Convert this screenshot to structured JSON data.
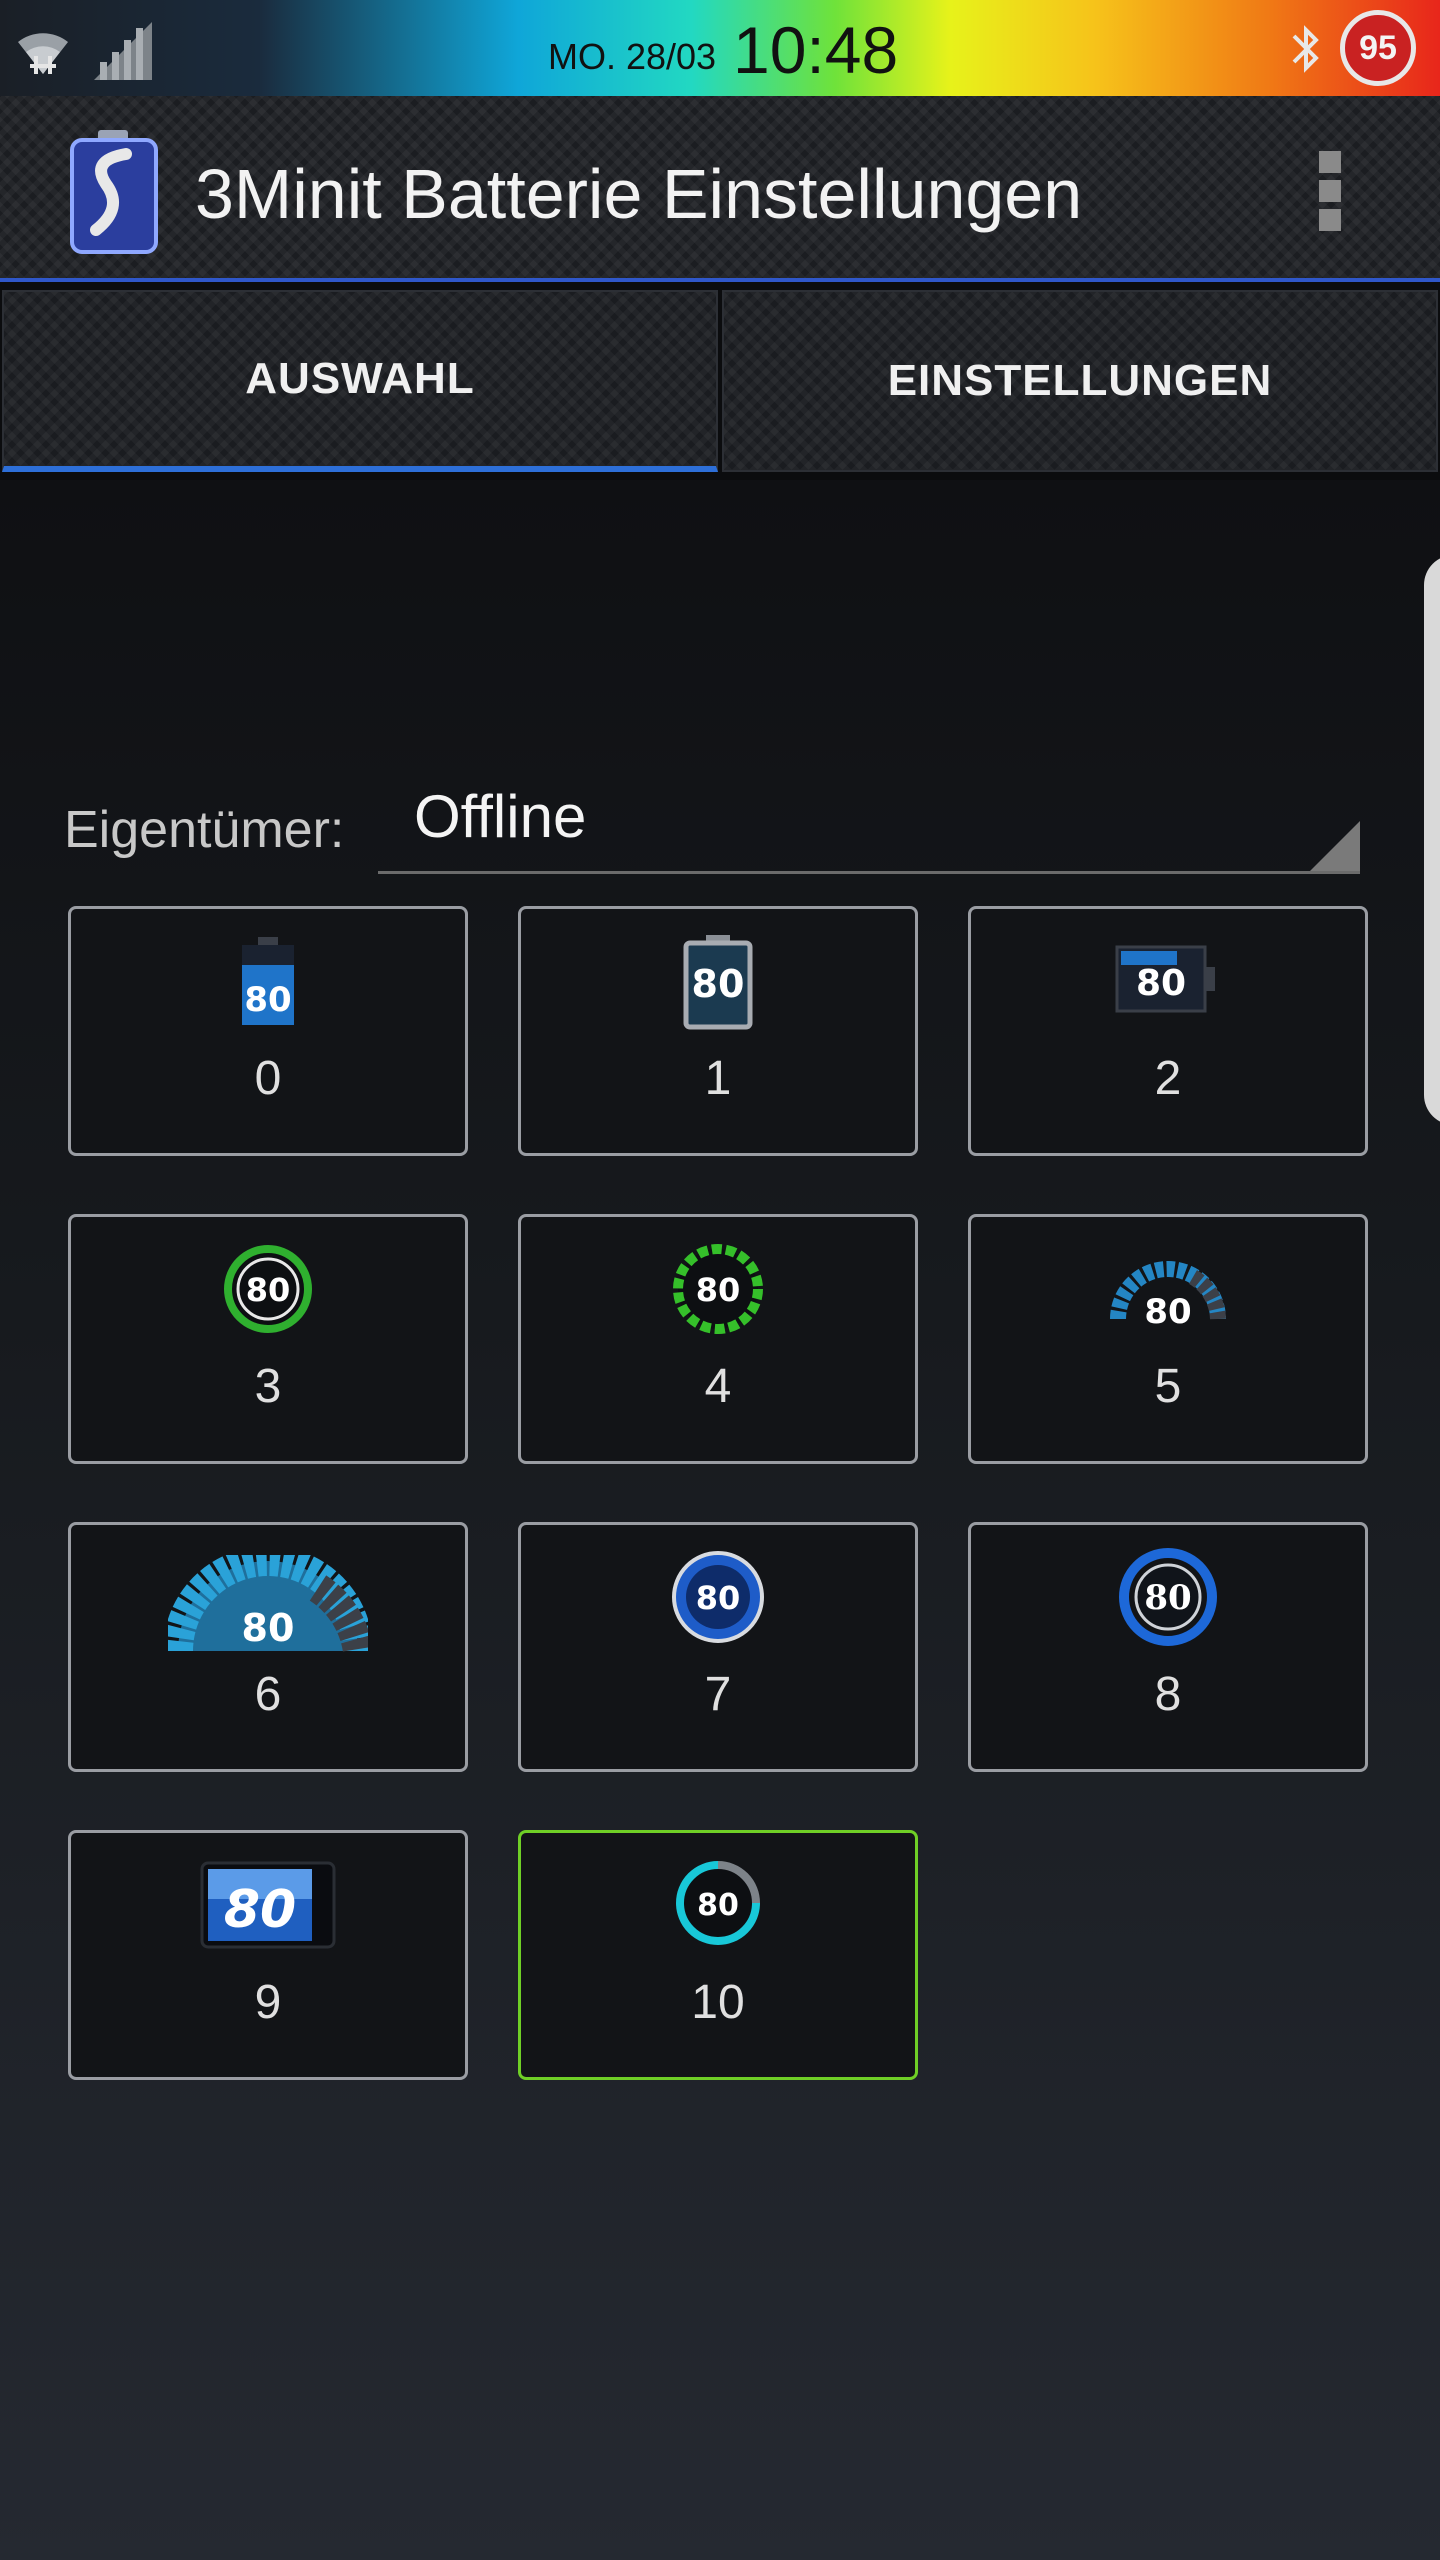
{
  "status_bar": {
    "date": "MO. 28/03",
    "time": "10:48",
    "battery_level": "95",
    "icons": [
      "wifi-icon",
      "signal-icon",
      "bluetooth-icon",
      "battery-icon"
    ]
  },
  "action_bar": {
    "title": "3Minit Batterie Einstellungen",
    "icons": [
      "app-logo-icon",
      "overflow-menu-icon"
    ]
  },
  "tabs": [
    {
      "label": "AUSWAHL",
      "active": true
    },
    {
      "label": "EINSTELLUNGEN",
      "active": false
    }
  ],
  "owner": {
    "label": "Eigentümer:",
    "value": "Offline"
  },
  "styles": {
    "preview_value": "80",
    "selected_index": 10,
    "items": [
      {
        "number": "0",
        "icon": "battery-vertical-icon"
      },
      {
        "number": "1",
        "icon": "battery-outline-icon"
      },
      {
        "number": "2",
        "icon": "battery-horizontal-icon"
      },
      {
        "number": "3",
        "icon": "green-ring-icon"
      },
      {
        "number": "4",
        "icon": "green-segmented-ring-icon"
      },
      {
        "number": "5",
        "icon": "blue-gauge-icon"
      },
      {
        "number": "6",
        "icon": "large-blue-gauge-icon"
      },
      {
        "number": "7",
        "icon": "blue-orb-icon"
      },
      {
        "number": "8",
        "icon": "blue-swirl-ring-icon"
      },
      {
        "number": "9",
        "icon": "blue-battery-bar-icon"
      },
      {
        "number": "10",
        "icon": "cyan-arc-icon"
      }
    ]
  },
  "colors": {
    "accent_blue": "#2d6fd8",
    "selected_green": "#6fcf26",
    "status_battery_red": "#c92222"
  }
}
